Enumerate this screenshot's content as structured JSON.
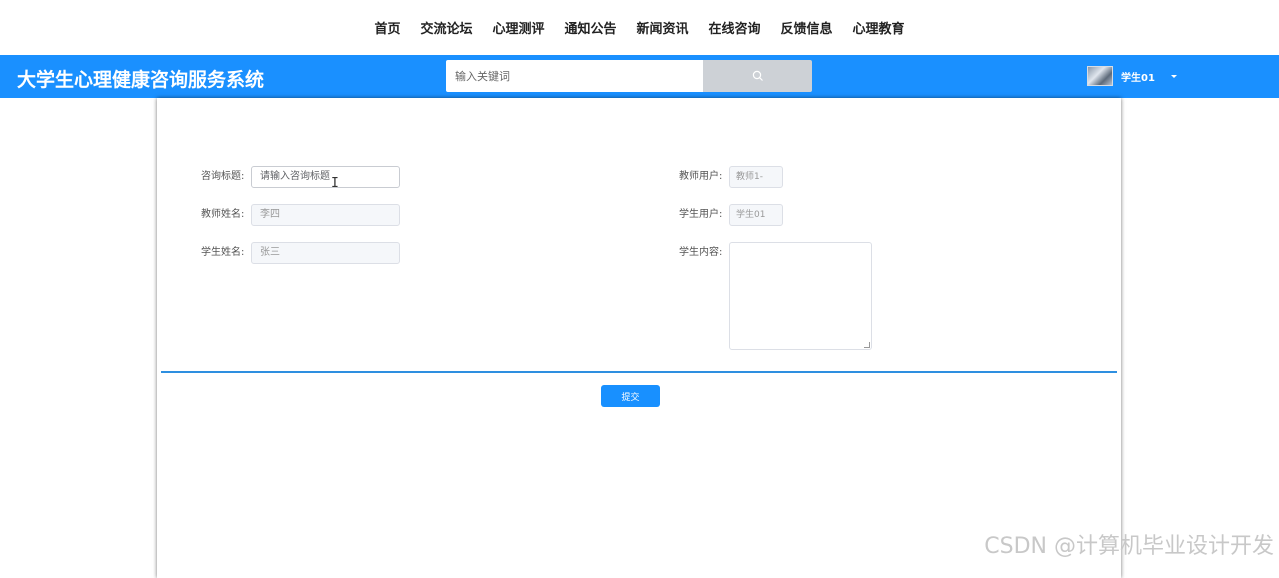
{
  "nav": {
    "items": [
      "首页",
      "交流论坛",
      "心理测评",
      "通知公告",
      "新闻资讯",
      "在线咨询",
      "反馈信息",
      "心理教育"
    ]
  },
  "header": {
    "title": "大学生心理健康咨询服务系统",
    "search_placeholder": "输入关键词",
    "search_icon": "search-icon",
    "user_name": "学生01",
    "accent_color": "#1a90ff"
  },
  "form": {
    "consult_title": {
      "label": "咨询标题:",
      "placeholder": "请输入咨询标题"
    },
    "teacher_name": {
      "label": "教师姓名:",
      "value": "李四"
    },
    "student_name": {
      "label": "学生姓名:",
      "value": "张三"
    },
    "teacher_user": {
      "label": "教师用户:",
      "value": "教师1-"
    },
    "student_user": {
      "label": "学生用户:",
      "value": "学生01"
    },
    "student_content": {
      "label": "学生内容:",
      "value": ""
    },
    "submit_label": "提交"
  },
  "watermark": "CSDN @计算机毕业设计开发"
}
